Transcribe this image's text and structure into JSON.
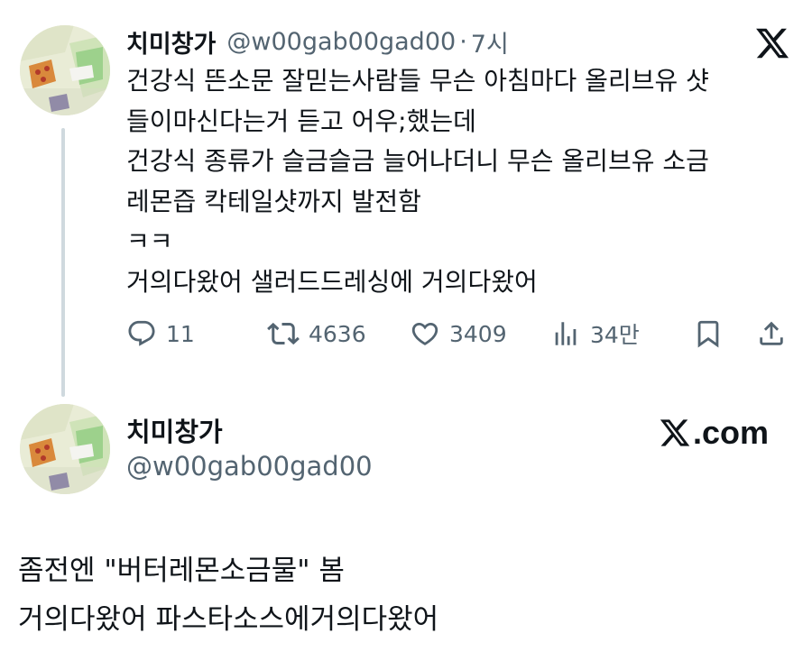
{
  "tweet": {
    "display_name": "치미창가",
    "handle": "@w00gab00gad00",
    "separator": "·",
    "time": "7시",
    "lines": [
      "건강식 뜬소문 잘믿는사람들 무슨 아침마다 올리브유 샷",
      "들이마신다는거 듣고 어우;했는데",
      "건강식 종류가 슬금슬금 늘어나더니 무슨 올리브유 소금",
      "레몬즙 칵테일샷까지 발전함",
      "ㅋㅋ",
      "거의다왔어 샐러드드레싱에 거의다왔어"
    ],
    "actions": {
      "replies": "11",
      "retweets": "4636",
      "likes": "3409",
      "views": "34만"
    }
  },
  "card": {
    "display_name": "치미창가",
    "handle": "@w00gab00gad00",
    "domain": ".com"
  },
  "footer": {
    "lines": [
      "좀전엔 \"버터레몬소금물\" 봄",
      "거의다왔어 파스타소스에거의다왔어"
    ]
  },
  "icons": {
    "x_logo": "x-logo-icon",
    "reply": "reply-icon",
    "retweet": "retweet-icon",
    "like": "heart-icon",
    "views": "views-icon",
    "bookmark": "bookmark-icon",
    "share": "share-icon"
  },
  "colors": {
    "text": "#0f1419",
    "secondary": "#536471",
    "thread_line": "#cfd9de"
  }
}
